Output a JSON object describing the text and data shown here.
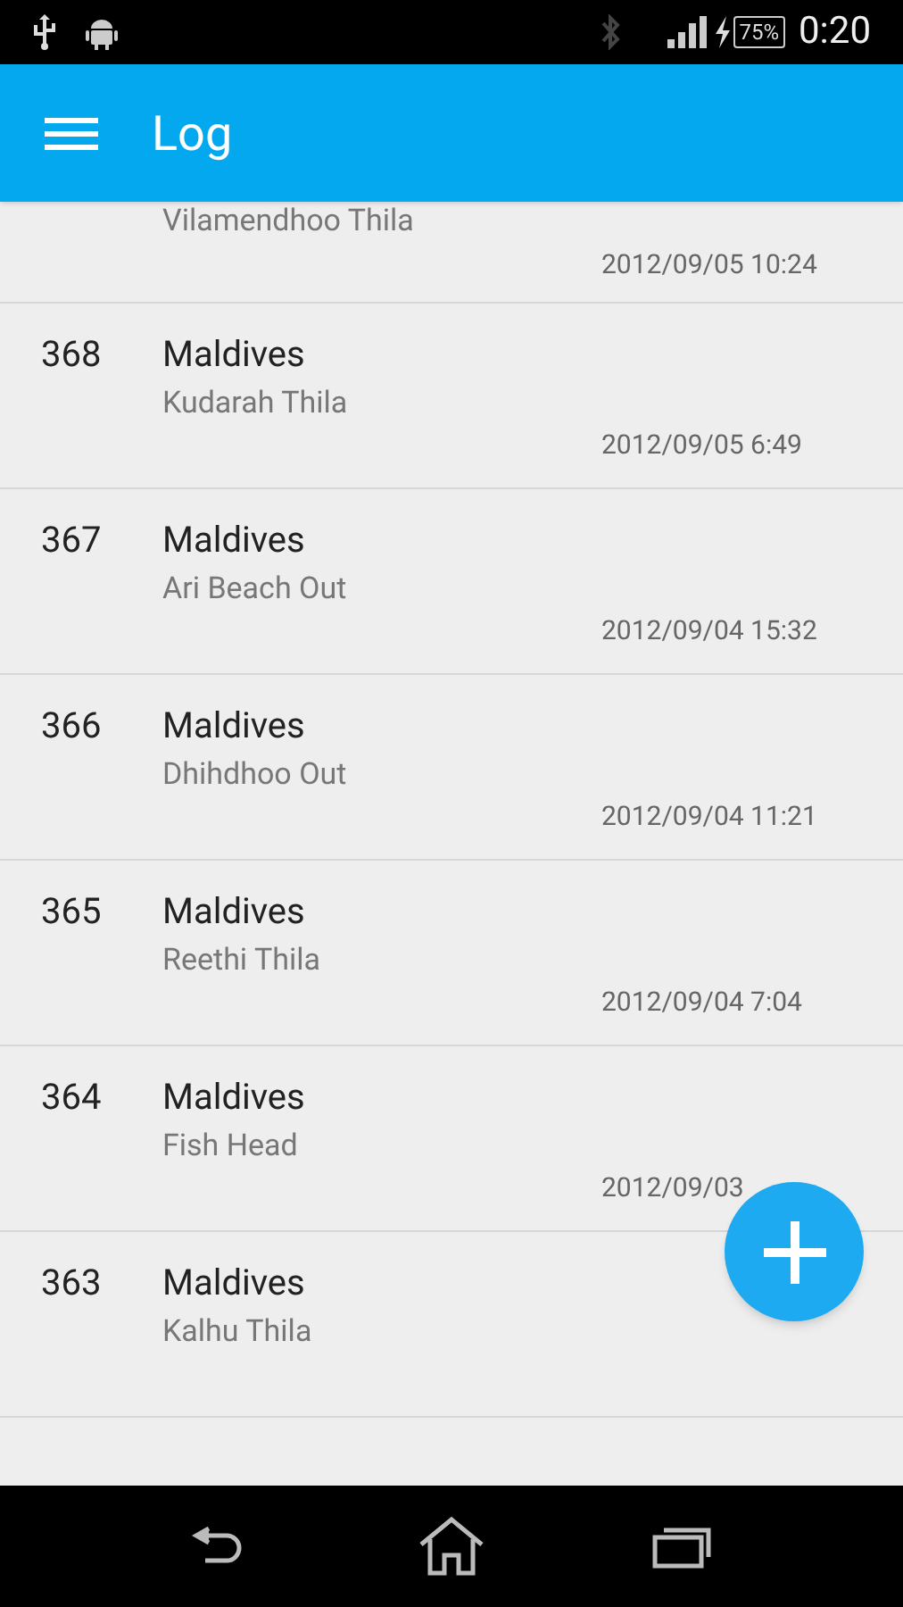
{
  "status_bar": {
    "battery": "75%",
    "time": "0:20"
  },
  "app_bar": {
    "title": "Log"
  },
  "entries": [
    {
      "subtitle": "Vilamendhoo Thila",
      "date": "2012/09/05 10:24"
    },
    {
      "number": "368",
      "title": "Maldives",
      "subtitle": "Kudarah Thila",
      "date": "2012/09/05 6:49"
    },
    {
      "number": "367",
      "title": "Maldives",
      "subtitle": "Ari Beach Out",
      "date": "2012/09/04 15:32"
    },
    {
      "number": "366",
      "title": "Maldives",
      "subtitle": "Dhihdhoo Out",
      "date": "2012/09/04 11:21"
    },
    {
      "number": "365",
      "title": "Maldives",
      "subtitle": "Reethi Thila",
      "date": "2012/09/04 7:04"
    },
    {
      "number": "364",
      "title": "Maldives",
      "subtitle": "Fish Head",
      "date": "2012/09/03"
    },
    {
      "number": "363",
      "title": "Maldives",
      "subtitle": "Kalhu Thila"
    }
  ]
}
